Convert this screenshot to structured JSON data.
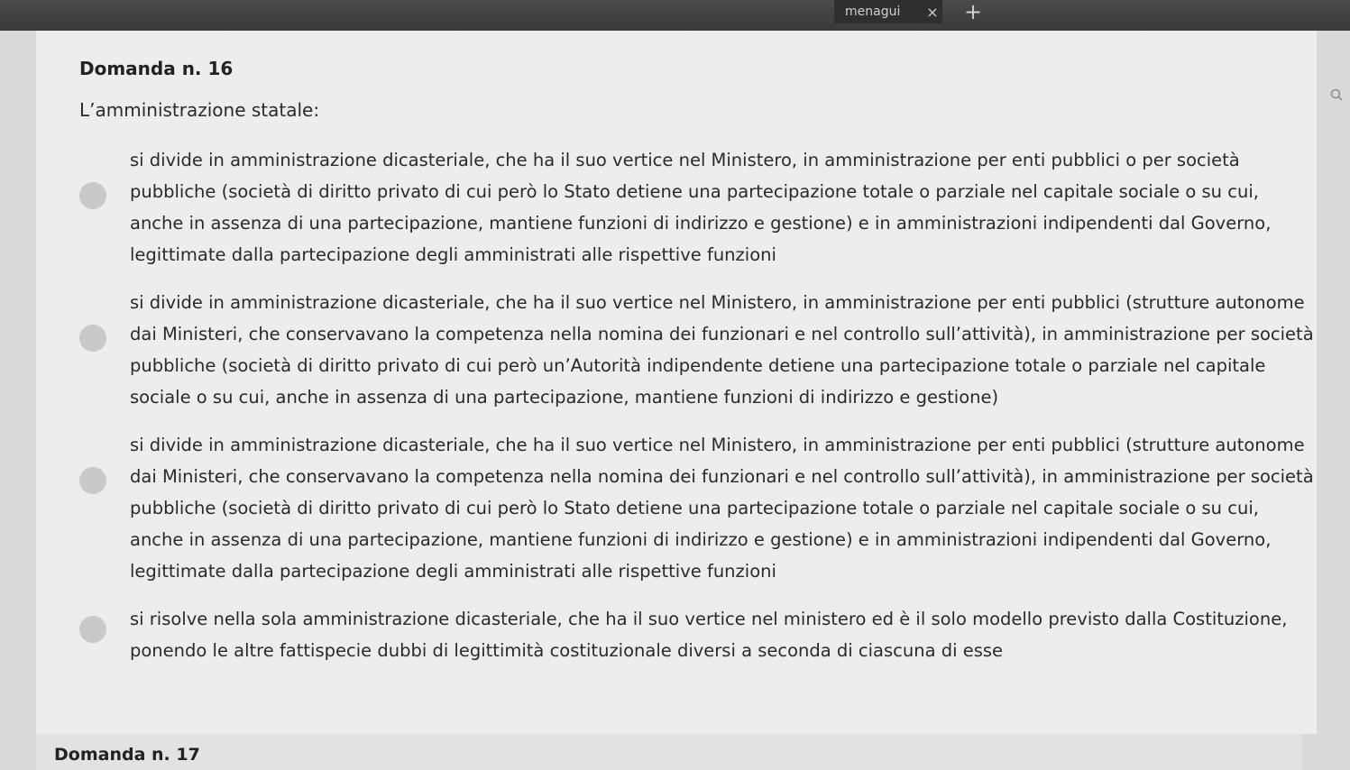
{
  "browser": {
    "tab_label": "menagui",
    "tab_close": "×",
    "new_tab": "+"
  },
  "question": {
    "title": "Domanda n. 16",
    "text": "L’amministrazione statale:",
    "options": [
      {
        "text": "si divide in amministrazione dicasteriale, che ha il suo vertice nel Ministero, in amministrazione per enti pubblici o per società pubbliche (società di diritto privato di cui però lo Stato detiene una partecipazione totale o parziale nel capitale sociale o su cui, anche in assenza di una partecipazione, mantiene funzioni di indirizzo e gestione) e in amministrazioni indipendenti dal Governo, legittimate dalla partecipazione degli amministrati alle rispettive funzioni"
      },
      {
        "text": "si divide in amministrazione dicasteriale, che ha il suo vertice nel Ministero, in amministrazione per enti pubblici (strutture autonome dai Ministeri, che conservavano la competenza nella nomina dei funzionari e nel controllo sull’attività), in amministrazione per società pubbliche (società di diritto privato di cui però un’Autorità indipendente detiene una partecipazione totale o parziale nel capitale sociale o su cui, anche in assenza di una partecipazione, mantiene funzioni di indirizzo e gestione)"
      },
      {
        "text": "si divide in amministrazione dicasteriale, che ha il suo vertice nel Ministero, in amministrazione per enti pubblici (strutture autonome dai Ministeri, che conservavano la competenza nella nomina dei funzionari e nel controllo sull’attività), in amministrazione per società pubbliche (società di diritto privato di cui però lo Stato detiene una partecipazione totale o parziale nel capitale sociale o su cui, anche in assenza di una partecipazione, mantiene funzioni di indirizzo e gestione) e in amministrazioni indipendenti dal Governo, legittimate dalla partecipazione degli amministrati alle rispettive funzioni"
      },
      {
        "text": "si risolve nella sola amministrazione dicasteriale, che ha il suo vertice nel ministero ed è il solo modello previsto dalla Costituzione, ponendo le altre fattispecie dubbi di legittimità costituzionale diversi a seconda di ciascuna di esse"
      }
    ]
  },
  "next_question": {
    "title": "Domanda n. 17"
  }
}
